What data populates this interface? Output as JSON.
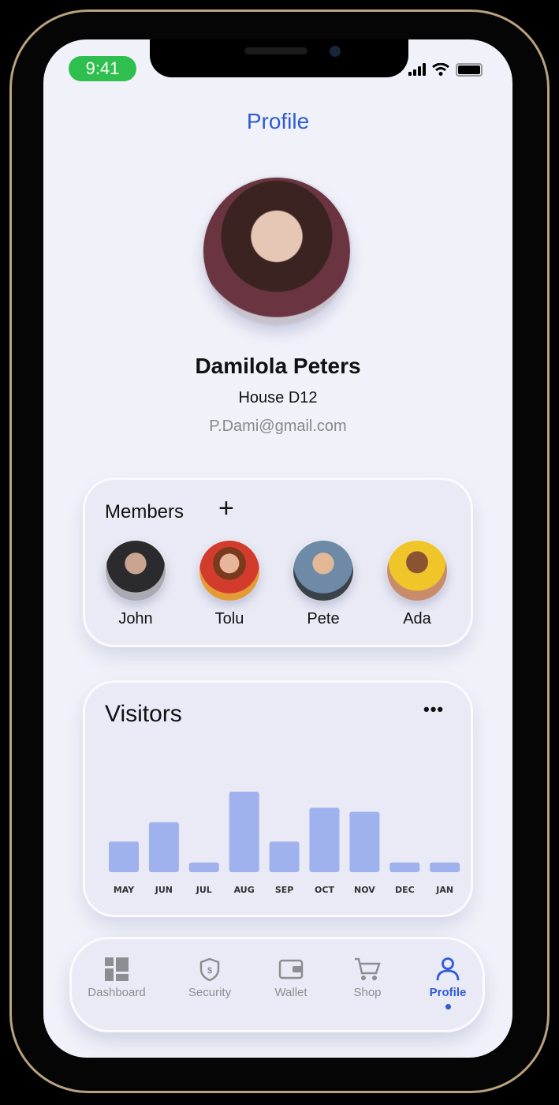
{
  "status_bar": {
    "time": "9:41"
  },
  "header": {
    "title": "Profile"
  },
  "profile": {
    "name": "Damilola Peters",
    "house": "House D12",
    "email": "P.Dami@gmail.com"
  },
  "members": {
    "label": "Members",
    "add_icon": "plus-icon",
    "items": [
      {
        "name": "John",
        "color": "#5a5f6a"
      },
      {
        "name": "Tolu",
        "color": "#d9822b"
      },
      {
        "name": "Pete",
        "color": "#4a6c86"
      },
      {
        "name": "Ada",
        "color": "#e2b72a"
      }
    ]
  },
  "visitors": {
    "title": "Visitors",
    "more_icon": "more-horizontal-icon"
  },
  "chart_data": {
    "type": "bar",
    "title": "Visitors",
    "categories": [
      "MAY",
      "JUN",
      "JUL",
      "AUG",
      "SEP",
      "OCT",
      "NOV",
      "DEC",
      "JAN"
    ],
    "values": [
      38,
      62,
      12,
      100,
      38,
      80,
      75,
      12,
      12
    ],
    "bar_color": "#9fb2ee",
    "grid": false,
    "axis_values_shown": false
  },
  "nav": {
    "items": [
      {
        "label": "Dashboard",
        "icon": "dashboard-icon",
        "active": false
      },
      {
        "label": "Security",
        "icon": "shield-icon",
        "active": false
      },
      {
        "label": "Wallet",
        "icon": "wallet-icon",
        "active": false
      },
      {
        "label": "Shop",
        "icon": "cart-icon",
        "active": false
      },
      {
        "label": "Profile",
        "icon": "user-icon",
        "active": true
      }
    ]
  },
  "colors": {
    "accent": "#2f5bd6",
    "time_pill": "#2fbf4f",
    "inactive": "#8d8d92"
  }
}
